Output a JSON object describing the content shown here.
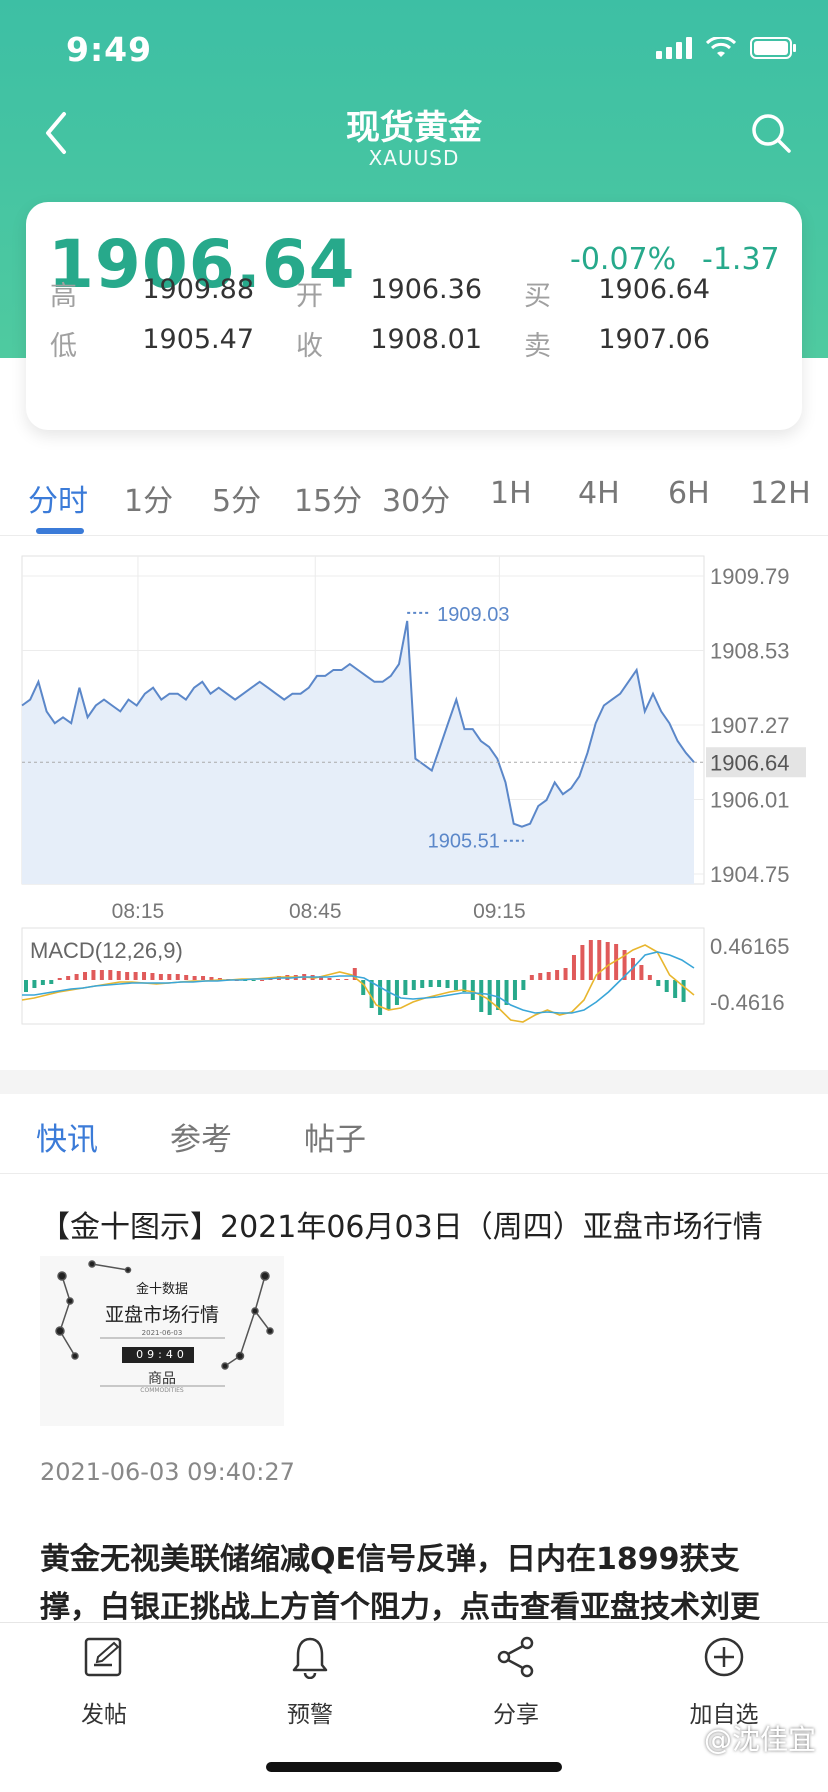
{
  "status": {
    "time": "9:49"
  },
  "nav": {
    "title": "现货黄金",
    "subtitle": "XAUUSD"
  },
  "quote": {
    "price": "1906.64",
    "change_pct": "-0.07%",
    "change_abs": "-1.37",
    "high_label": "高",
    "high": "1909.88",
    "open_label": "开",
    "open": "1906.36",
    "buy_label": "买",
    "buy": "1906.64",
    "low_label": "低",
    "low": "1905.47",
    "close_label": "收",
    "close": "1908.01",
    "sell_label": "卖",
    "sell": "1907.06",
    "up_color": "#27a98b"
  },
  "period_tabs": [
    "分时",
    "1分",
    "5分",
    "15分",
    "30分",
    "1H",
    "4H",
    "6H",
    "12H"
  ],
  "active_period": 0,
  "chart_data": [
    {
      "type": "area",
      "y_ticks": [
        "1909.79",
        "1908.53",
        "1907.27",
        "1906.01",
        "1904.75"
      ],
      "ylim": [
        1904.75,
        1909.79
      ],
      "x_ticks": [
        "08:15",
        "08:45",
        "09:15"
      ],
      "current_label": "1906.64",
      "max_label": "1909.03",
      "min_label": "1905.51",
      "series": [
        {
          "values": [
            1907.6,
            1907.7,
            1908.0,
            1907.5,
            1907.3,
            1907.4,
            1907.3,
            1907.9,
            1907.4,
            1907.6,
            1907.7,
            1907.6,
            1907.5,
            1907.7,
            1907.6,
            1907.8,
            1907.9,
            1907.7,
            1907.8,
            1907.8,
            1907.7,
            1907.9,
            1908.0,
            1907.8,
            1907.9,
            1907.8,
            1907.7,
            1907.8,
            1907.9,
            1908.0,
            1907.9,
            1907.8,
            1907.7,
            1907.8,
            1907.8,
            1907.9,
            1908.1,
            1908.1,
            1908.2,
            1908.2,
            1908.3,
            1908.2,
            1908.1,
            1908.0,
            1908.0,
            1908.1,
            1908.3,
            1909.03,
            1906.7,
            1906.6,
            1906.5,
            1906.9,
            1907.3,
            1907.7,
            1907.2,
            1907.2,
            1907.0,
            1906.9,
            1906.7,
            1906.3,
            1905.6,
            1905.55,
            1905.6,
            1905.9,
            1906.0,
            1906.3,
            1906.1,
            1906.2,
            1906.4,
            1906.8,
            1907.3,
            1907.6,
            1907.7,
            1907.8,
            1908.0,
            1908.2,
            1907.5,
            1907.8,
            1907.5,
            1907.3,
            1907.0,
            1906.8,
            1906.64
          ]
        }
      ]
    },
    {
      "type": "bar",
      "title": "MACD(12,26,9)",
      "y_ticks": [
        "0.46165",
        "-0.4616"
      ],
      "ylim": [
        -0.4616,
        0.46165
      ],
      "histogram": [
        -0.12,
        -0.08,
        -0.05,
        -0.04,
        0.02,
        0.04,
        0.06,
        0.08,
        0.1,
        0.1,
        0.1,
        0.09,
        0.08,
        0.08,
        0.08,
        0.07,
        0.06,
        0.06,
        0.06,
        0.05,
        0.04,
        0.04,
        0.03,
        0.02,
        0.01,
        0,
        -0.01,
        -0.01,
        0,
        0.02,
        0.04,
        0.05,
        0.05,
        0.06,
        0.05,
        0.04,
        0.02,
        0.01,
        0.01,
        0.12,
        -0.15,
        -0.28,
        -0.35,
        -0.3,
        -0.25,
        -0.15,
        -0.1,
        -0.08,
        -0.07,
        -0.07,
        -0.08,
        -0.1,
        -0.12,
        -0.2,
        -0.32,
        -0.35,
        -0.3,
        -0.25,
        -0.2,
        -0.1,
        0.05,
        0.07,
        0.08,
        0.1,
        0.12,
        0.25,
        0.35,
        0.4,
        0.4,
        0.38,
        0.36,
        0.3,
        0.22,
        0.15,
        0.05,
        -0.06,
        -0.12,
        -0.18,
        -0.22
      ],
      "series": [
        {
          "values": [
            -0.2,
            -0.18,
            -0.15,
            -0.12,
            -0.1,
            -0.08,
            -0.06,
            -0.04,
            -0.02,
            -0.02,
            -0.03,
            -0.04,
            -0.03,
            -0.02,
            -0.01,
            -0.01,
            0.0,
            0.0,
            0.01,
            0.01,
            0.02,
            0.03,
            0.03,
            0.03,
            0.02,
            0.05,
            0.08,
            0.05,
            -0.05,
            -0.25,
            -0.3,
            -0.28,
            -0.22,
            -0.18,
            -0.15,
            -0.12,
            -0.1,
            -0.12,
            -0.18,
            -0.28,
            -0.4,
            -0.42,
            -0.35,
            -0.3,
            -0.35,
            -0.32,
            -0.2,
            0.05,
            0.15,
            0.22,
            0.3,
            0.35,
            0.28,
            0.05,
            -0.05,
            -0.15
          ]
        },
        {
          "values": [
            -0.15,
            -0.15,
            -0.13,
            -0.11,
            -0.09,
            -0.08,
            -0.06,
            -0.05,
            -0.04,
            -0.03,
            -0.03,
            -0.03,
            -0.03,
            -0.02,
            -0.02,
            -0.01,
            -0.01,
            0.0,
            0.0,
            0.01,
            0.01,
            0.02,
            0.02,
            0.03,
            0.03,
            0.03,
            0.04,
            0.04,
            0.02,
            -0.05,
            -0.12,
            -0.18,
            -0.19,
            -0.18,
            -0.17,
            -0.15,
            -0.13,
            -0.13,
            -0.14,
            -0.17,
            -0.25,
            -0.3,
            -0.33,
            -0.32,
            -0.33,
            -0.33,
            -0.3,
            -0.22,
            -0.12,
            0.0,
            0.12,
            0.25,
            0.28,
            0.25,
            0.2,
            0.12
          ]
        }
      ]
    }
  ],
  "news_tabs": [
    "快讯",
    "参考",
    "帖子"
  ],
  "news": {
    "title": "【金十图示】2021年06月03日（周四）亚盘市场行情",
    "thumb": {
      "brand": "金十数据",
      "heading": "亚盘市场行情",
      "date": "2021-06-03",
      "clock": "09:40",
      "category": "商品",
      "category_en": "COMMODITIES"
    },
    "time": "2021-06-03 09:40:27",
    "second": "黄金无视美联储缩减QE信号反弹，日内在1899获支撑，白银正挑战上方首个阻力，点击查看亚盘技术刘更"
  },
  "bottom": {
    "post": "发帖",
    "alert": "预警",
    "share": "分享",
    "watch": "加自选"
  },
  "watermark": "@沈佳宜",
  "colors": {
    "accent": "#3b7bd8",
    "teal": "#3dbfa4",
    "red": "#e05a5a",
    "green": "#27a98b"
  }
}
